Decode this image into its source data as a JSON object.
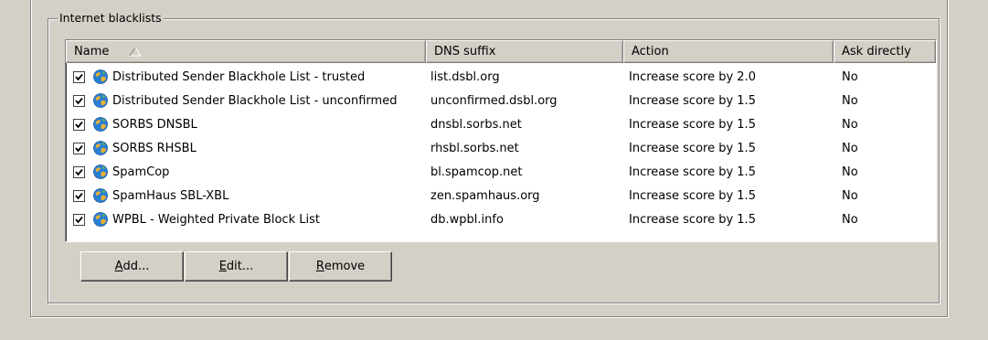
{
  "group": {
    "title": "Internet blacklists"
  },
  "columns": [
    {
      "label": "Name"
    },
    {
      "label": "DNS suffix"
    },
    {
      "label": "Action"
    },
    {
      "label": "Ask directly"
    }
  ],
  "sort_indicator": "sort-ascending-icon",
  "rows": [
    {
      "checked": true,
      "icon": "globe-icon",
      "name": "Distributed Sender Blackhole List - trusted",
      "dns": "list.dsbl.org",
      "action": "Increase score by 2.0",
      "ask": "No"
    },
    {
      "checked": true,
      "icon": "globe-icon",
      "name": "Distributed Sender Blackhole List - unconfirmed",
      "dns": "unconfirmed.dsbl.org",
      "action": "Increase score by 1.5",
      "ask": "No"
    },
    {
      "checked": true,
      "icon": "globe-icon",
      "name": "SORBS DNSBL",
      "dns": "dnsbl.sorbs.net",
      "action": "Increase score by 1.5",
      "ask": "No"
    },
    {
      "checked": true,
      "icon": "globe-icon",
      "name": "SORBS RHSBL",
      "dns": "rhsbl.sorbs.net",
      "action": "Increase score by 1.5",
      "ask": "No"
    },
    {
      "checked": true,
      "icon": "globe-icon",
      "name": "SpamCop",
      "dns": "bl.spamcop.net",
      "action": "Increase score by 1.5",
      "ask": "No"
    },
    {
      "checked": true,
      "icon": "globe-icon",
      "name": "SpamHaus SBL-XBL",
      "dns": "zen.spamhaus.org",
      "action": "Increase score by 1.5",
      "ask": "No"
    },
    {
      "checked": true,
      "icon": "globe-icon",
      "name": "WPBL - Weighted Private Block List",
      "dns": "db.wpbl.info",
      "action": "Increase score by 1.5",
      "ask": "No"
    }
  ],
  "buttons": {
    "add": {
      "mnemonic": "A",
      "rest": "dd..."
    },
    "edit": {
      "mnemonic": "E",
      "rest": "dit..."
    },
    "remove": {
      "mnemonic": "R",
      "rest": "emove"
    }
  },
  "colors": {
    "dialog_bg": "#d4d0c8",
    "list_bg": "#ffffff",
    "globe_blue": "#2a7fd4",
    "globe_gold": "#e8b030"
  }
}
